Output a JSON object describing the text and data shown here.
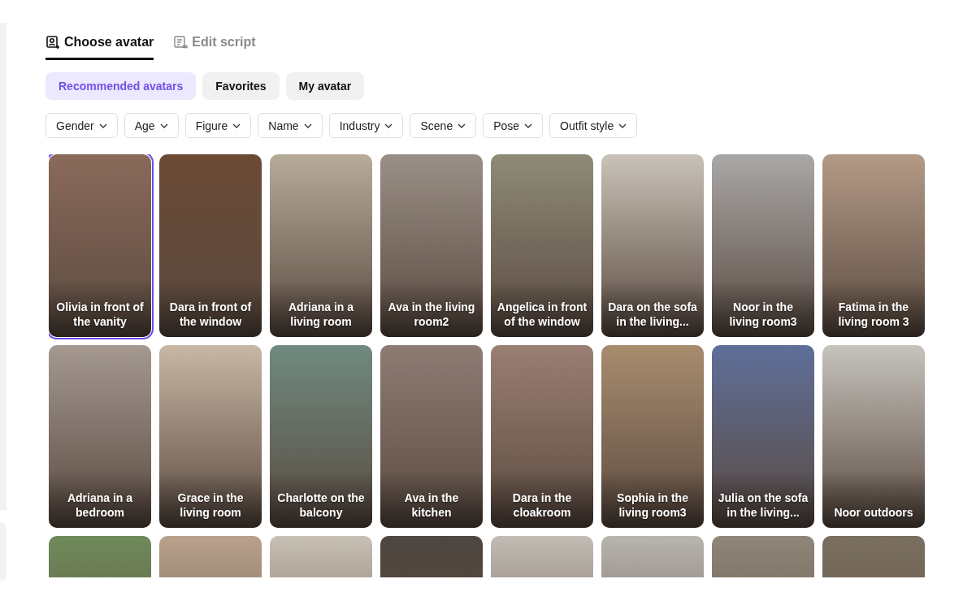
{
  "tabs": [
    {
      "label": "Choose avatar",
      "selected": true
    },
    {
      "label": "Edit script",
      "selected": false
    }
  ],
  "categories": [
    {
      "label": "Recommended avatars",
      "selected": true
    },
    {
      "label": "Favorites",
      "selected": false
    },
    {
      "label": "My avatar",
      "selected": false
    }
  ],
  "filters": [
    {
      "label": "Gender"
    },
    {
      "label": "Age"
    },
    {
      "label": "Figure"
    },
    {
      "label": "Name"
    },
    {
      "label": "Industry"
    },
    {
      "label": "Scene"
    },
    {
      "label": "Pose"
    },
    {
      "label": "Outfit style"
    }
  ],
  "avatars": [
    {
      "name": "Olivia in front of the vanity",
      "selected": true
    },
    {
      "name": "Dara in front of the window",
      "selected": false
    },
    {
      "name": "Adriana in a living room",
      "selected": false
    },
    {
      "name": "Ava in the living room2",
      "selected": false
    },
    {
      "name": "Angelica in front of the window",
      "selected": false
    },
    {
      "name": "Dara on the sofa in the living...",
      "selected": false
    },
    {
      "name": "Noor in the living room3",
      "selected": false
    },
    {
      "name": "Fatima in the living room 3",
      "selected": false
    },
    {
      "name": "Adriana in a bedroom",
      "selected": false
    },
    {
      "name": "Grace in the living room",
      "selected": false
    },
    {
      "name": "Charlotte on the balcony",
      "selected": false
    },
    {
      "name": "Ava in the kitchen",
      "selected": false
    },
    {
      "name": "Dara in the cloakroom",
      "selected": false
    },
    {
      "name": "Sophia in the living room3",
      "selected": false
    },
    {
      "name": "Julia on the sofa in the living...",
      "selected": false
    },
    {
      "name": "Noor outdoors",
      "selected": false
    },
    {
      "selected": false
    },
    {
      "selected": false
    },
    {
      "selected": false
    },
    {
      "selected": false
    },
    {
      "selected": false
    },
    {
      "selected": false
    },
    {
      "selected": false
    },
    {
      "selected": false
    }
  ]
}
